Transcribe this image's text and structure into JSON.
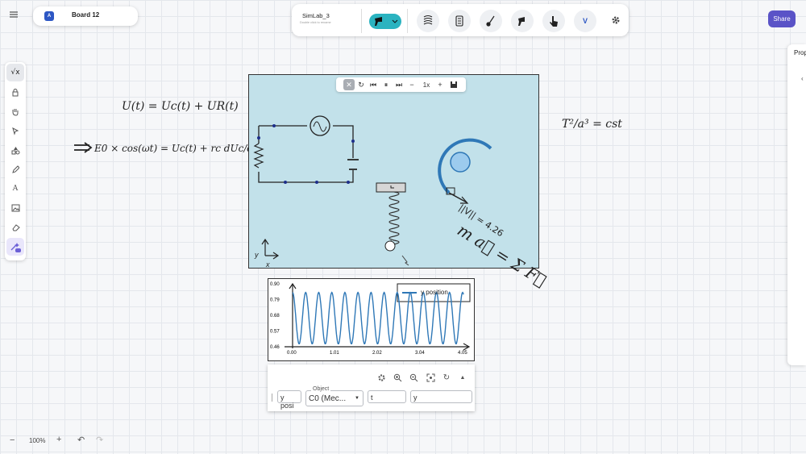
{
  "board": {
    "title": "Board 12",
    "logo_text": "A"
  },
  "simlab": {
    "title": "SimLab_3",
    "subtitle": "Double click to rename"
  },
  "toolbar": {
    "v_label": "V"
  },
  "share": {
    "label": "Share"
  },
  "right_panel": {
    "label": "Prop"
  },
  "zoom": {
    "level": "100%"
  },
  "player": {
    "speed": "1x"
  },
  "formulas": {
    "u_eq": "U(t) = Uc(t) + UR(t)",
    "e_eq": "E0 × cos(ωt) = Uc(t) + rc dUc/dt",
    "kepler": "T²/a³ = cst",
    "newton": "m a⃗ = Σ F⃗"
  },
  "sim": {
    "velocity_label": "||V|| = 4.26",
    "axis_y": "y",
    "axis_x": "x"
  },
  "chart_data": {
    "type": "line",
    "legend": "y position",
    "x_ticks": [
      "0.00",
      "1.01",
      "2.02",
      "3.04",
      "4.05"
    ],
    "y_ticks": [
      "0.46",
      "0.57",
      "0.68",
      "0.79",
      "0.90"
    ],
    "xlim": [
      0,
      4.05
    ],
    "ylim": [
      0.46,
      0.9
    ],
    "series": [
      {
        "name": "y position",
        "amplitude_min": 0.48,
        "amplitude_max": 0.84,
        "period": 0.31,
        "t_start": 0,
        "t_end": 4.05
      }
    ]
  },
  "chart_controls": {
    "series_field": "y posi",
    "object_label": "Object",
    "object_value": "C0 (Mec...",
    "x_field": "t",
    "y_field": "y"
  },
  "colors": {
    "sim_bg": "#c2e1ea",
    "accent": "#5a53c7",
    "series": "#2f78b7",
    "teal": "#2bb3c0"
  }
}
